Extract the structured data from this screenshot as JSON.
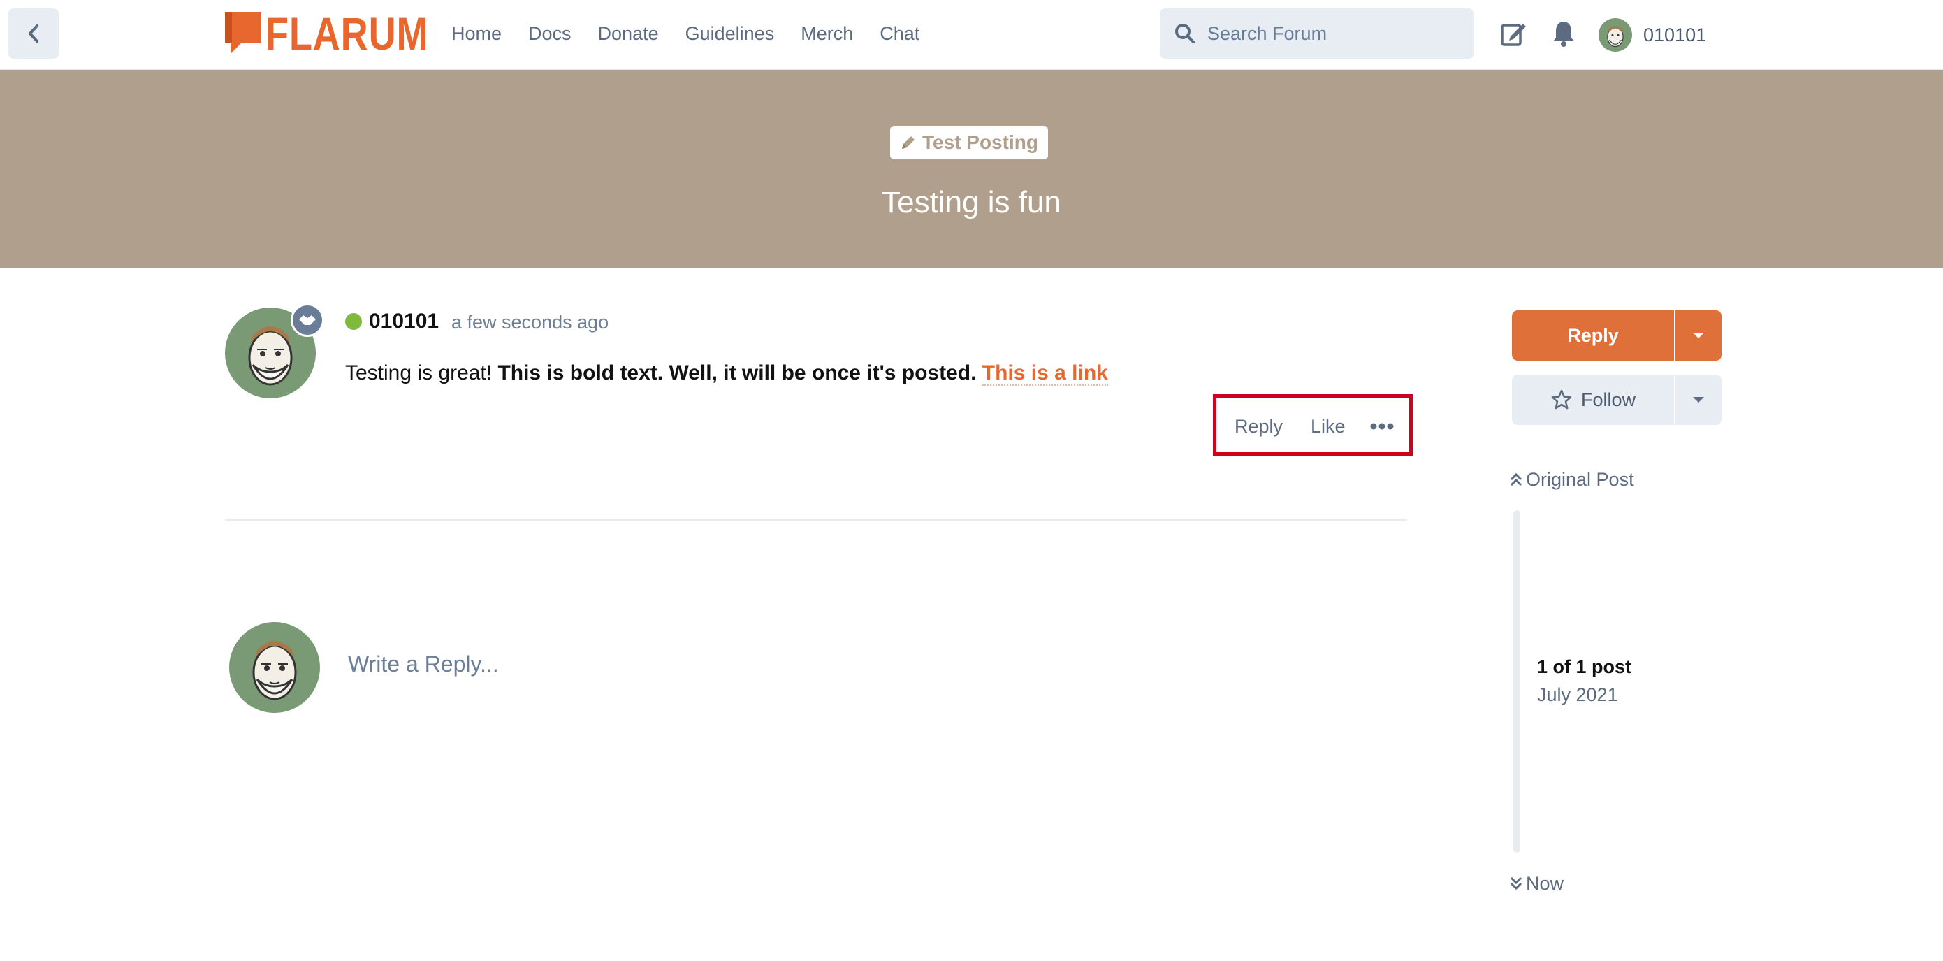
{
  "header": {
    "logo_text": "FLARUM",
    "nav": [
      "Home",
      "Docs",
      "Donate",
      "Guidelines",
      "Merch",
      "Chat"
    ],
    "search_placeholder": "Search Forum",
    "username": "010101"
  },
  "hero": {
    "tag_label": "Test Posting",
    "title": "Testing is fun"
  },
  "post": {
    "author": "010101",
    "time": "a few seconds ago",
    "body_plain": "Testing is great! ",
    "body_bold": "This is bold text. Well, it will be once it's posted. ",
    "body_link": "This is a link",
    "actions": {
      "reply": "Reply",
      "like": "Like"
    }
  },
  "composer": {
    "placeholder": "Write a Reply..."
  },
  "sidebar": {
    "reply_label": "Reply",
    "follow_label": "Follow",
    "original_post": "Original Post",
    "count": "1 of 1 post",
    "date": "July 2021",
    "now": "Now"
  },
  "colors": {
    "accent": "#e7672e",
    "hero_bg": "#af9f8c",
    "highlight_box": "#d0021b",
    "online": "#7fba3a"
  },
  "icons": [
    "chevron-left-icon",
    "search-icon",
    "compose-icon",
    "bell-icon",
    "pencil-icon",
    "more-icon",
    "star-icon",
    "caret-down-icon",
    "double-chevron-up-icon",
    "double-chevron-down-icon"
  ]
}
